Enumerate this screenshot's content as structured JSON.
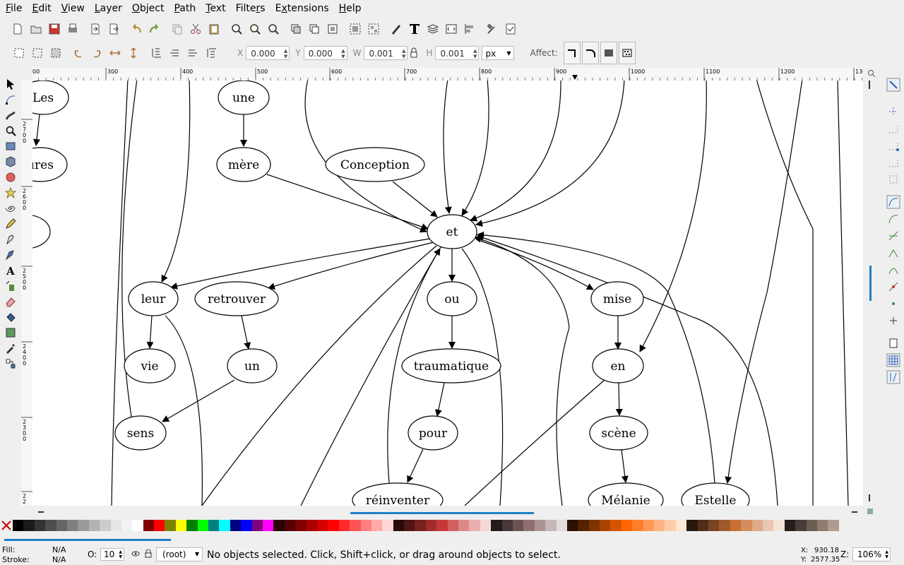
{
  "menu": [
    "File",
    "Edit",
    "View",
    "Layer",
    "Object",
    "Path",
    "Text",
    "Filters",
    "Extensions",
    "Help"
  ],
  "menu_underline": [
    "F",
    "E",
    "V",
    "L",
    "O",
    "P",
    "T",
    "r",
    "x",
    "H"
  ],
  "controls": {
    "x_label": "X",
    "x_value": "0.000",
    "y_label": "Y",
    "y_value": "0.000",
    "w_label": "W",
    "w_value": "0.001",
    "h_label": "H",
    "h_value": "0.001",
    "unit": "px",
    "affect_label": "Affect:"
  },
  "ruler": {
    "h_ticks": [
      "00",
      "300",
      "400",
      "500",
      "600",
      "700",
      "800",
      "900",
      "1000",
      "1100",
      "1200",
      "130"
    ],
    "v_ticks": [
      "2\n7\n0\n0",
      "2\n6\n0\n0",
      "2\n5\n0\n0",
      "2\n4\n0\n0",
      "2\n3\n0\n0",
      "2\n2"
    ]
  },
  "graph": {
    "nodes": [
      "Les",
      "ures",
      "une",
      "mère",
      "Conception",
      "et",
      "leur",
      "retrouver",
      "ou",
      "mise",
      "vie",
      "un",
      "traumatique",
      "en",
      "sens",
      "pour",
      "scène",
      "réinventer",
      "Mélanie",
      "Estelle"
    ]
  },
  "palette": {
    "none_icon": "x-icon",
    "colors": [
      "#000000",
      "#1a1a1a",
      "#333333",
      "#4d4d4d",
      "#666666",
      "#808080",
      "#999999",
      "#b3b3b3",
      "#cccccc",
      "#e6e6e6",
      "#f2f2f2",
      "#ffffff",
      "#800000",
      "#ff0000",
      "#808000",
      "#ffff00",
      "#008000",
      "#00ff00",
      "#008080",
      "#00ffff",
      "#000080",
      "#0000ff",
      "#800080",
      "#ff00ff",
      "#2b0000",
      "#550000",
      "#800000",
      "#aa0000",
      "#d40000",
      "#ff0000",
      "#ff2a2a",
      "#ff5555",
      "#ff8080",
      "#ffaaaa",
      "#ffd5d5",
      "#280b0b",
      "#501616",
      "#782121",
      "#a02c2c",
      "#c83737",
      "#d35f5f",
      "#de8787",
      "#e9afaf",
      "#f4d7d7",
      "#241c1c",
      "#483737",
      "#6c5353",
      "#916f6f",
      "#ac9393",
      "#c8b7b7",
      "#e3dbdb",
      "#2b1100",
      "#552200",
      "#803300",
      "#aa4400",
      "#d45500",
      "#ff6600",
      "#ff7f2a",
      "#ff9955",
      "#ffb380",
      "#ffccaa",
      "#ffe6d5",
      "#28170b",
      "#502d16",
      "#784421",
      "#a05a2c",
      "#c87137",
      "#d38d5f",
      "#deaa87",
      "#e9c6af",
      "#f4e3d7",
      "#241f1c",
      "#483e37",
      "#6c5d53",
      "#917c6f",
      "#ac9d93"
    ]
  },
  "status": {
    "fill_label": "Fill:",
    "fill_value": "N/A",
    "stroke_label": "Stroke:",
    "stroke_value": "N/A",
    "opacity_label": "O:",
    "opacity_value": "10",
    "layer": "(root)",
    "message": "No objects selected. Click, Shift+click, or drag around objects to select.",
    "x_label": "X:",
    "x_value": "930.18",
    "y_label": "Y:",
    "y_value": "2577.35",
    "zoom_label": "Z:",
    "zoom_value": "106%"
  }
}
